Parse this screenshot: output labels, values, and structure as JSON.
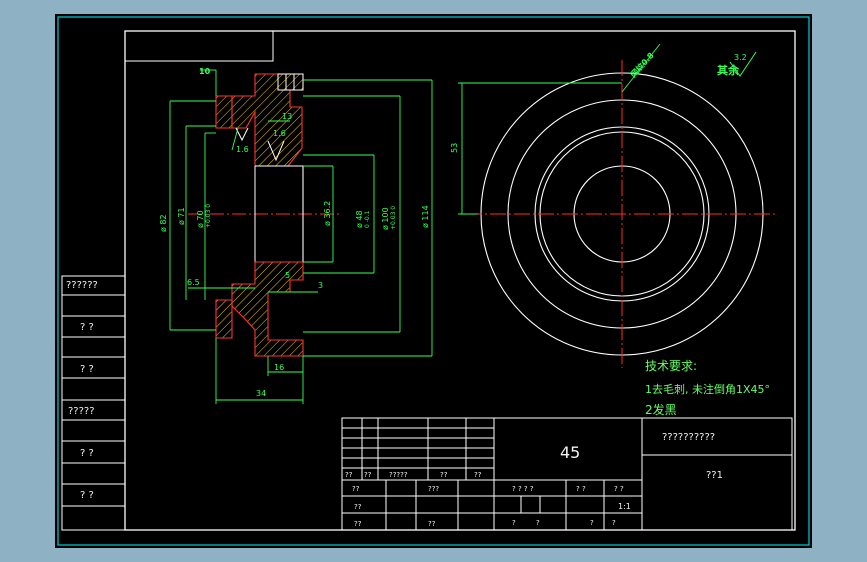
{
  "colors": {
    "app_background": "#8fb1c4",
    "canvas": "#000000",
    "frame": "#00cfd8",
    "line": "#ffffff",
    "dimension": "#33ff55",
    "centerline": "#ff2a2a",
    "hatch": "#ffcc00",
    "section_outline": "#ff3333",
    "tech_text": "#66ff66"
  },
  "dimensions": {
    "d10": "10",
    "d13": "13",
    "d1_6": "1.6",
    "d1_6b": "1.6",
    "d82": "ø 82",
    "d71": "ø 71",
    "d70": "ø 70",
    "d70_tol": "+0.03 0",
    "d36_2": "ø 36.2",
    "d48": "ø 48",
    "d48_tol": "0 -0.1",
    "d100": "ø 100",
    "d100_tol": "+0.03 0",
    "d114": "ø 114",
    "d6_5": "6.5",
    "d3": "3",
    "d5": "5",
    "d16": "16",
    "d34": "34",
    "d53": "53",
    "knurl": "网纹0.8",
    "rest_label": "其余",
    "rest_value": "3.2"
  },
  "tech_requirements": {
    "heading": "技术要求:",
    "item1": "1去毛刺, 未注倒角1X45°",
    "item2": "2发黑"
  },
  "left_stamps": [
    "??????",
    "? ?",
    "? ?",
    "?????",
    "? ?",
    "? ?"
  ],
  "title_block": {
    "material": "45",
    "part_name": "??????????",
    "drawing_no": "??1",
    "row_a": [
      "??",
      "??",
      "?????",
      "??",
      "??"
    ],
    "row_b": [
      "??",
      "???"
    ],
    "row_c": [
      "??"
    ],
    "row_d": [
      "??",
      "??"
    ],
    "stage_labels": [
      "? ? ? ?",
      "? ?",
      "? ?"
    ],
    "scale": "1:1",
    "sheet_labels": [
      "?",
      "?",
      "?",
      "?"
    ]
  }
}
